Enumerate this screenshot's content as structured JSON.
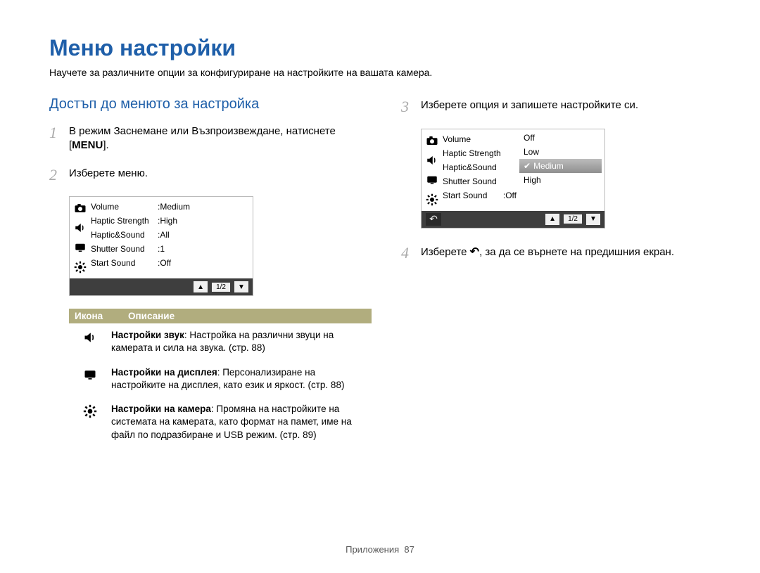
{
  "title": "Меню настройки",
  "intro": "Научете за различните опции за конфигуриране на настройките на вашата камера.",
  "section_head": "Достъп до менюто за настройка",
  "steps": {
    "s1_a": "В режим Заснемане или Възпроизвеждане, натиснете [",
    "s1_menu": "MENU",
    "s1_b": "].",
    "s2": "Изберете меню.",
    "s3": "Изберете опция и запишете настройките си.",
    "s4_a": "Изберете ",
    "s4_b": ", за да се върнете на предишния екран."
  },
  "step_numbers": [
    "1",
    "2",
    "3",
    "4"
  ],
  "cam1": {
    "rows": [
      {
        "label": "Volume",
        "val": ":Medium"
      },
      {
        "label": "Haptic Strength",
        "val": ":High"
      },
      {
        "label": "Haptic&Sound",
        "val": ":All"
      },
      {
        "label": "Shutter Sound",
        "val": ":1"
      },
      {
        "label": "Start Sound",
        "val": ":Off"
      }
    ],
    "page": "1/2"
  },
  "cam2": {
    "rows": [
      {
        "label": "Volume"
      },
      {
        "label": "Haptic Strength"
      },
      {
        "label": "Haptic&Sound"
      },
      {
        "label": "Shutter Sound"
      },
      {
        "label": "Start Sound",
        "val": ":Off"
      }
    ],
    "options": [
      "Off",
      "Low",
      "Medium",
      "High"
    ],
    "selected": 2,
    "page": "1/2"
  },
  "icons": {
    "camera_label": "camera-icon",
    "sound_label": "sound-settings-icon",
    "display_label": "display-settings-icon",
    "camgear_label": "camera-gear-icon",
    "up_label": "up-icon",
    "down_label": "down-icon",
    "back_label": "back-icon"
  },
  "table": {
    "head1": "Икона",
    "head2": "Описание",
    "rows": [
      {
        "icon": "sound",
        "bold": "Настройки звук",
        "text": ": Настройка на различни звуци на камерата и сила на звука. (стр. 88)"
      },
      {
        "icon": "display",
        "bold": "Настройки на дисплея",
        "text": ": Персонализиране на настройките на дисплея, като език и яркост. (стр. 88)"
      },
      {
        "icon": "camgear",
        "bold": "Настройки на камера",
        "text": ": Промяна на настройките на системата на камерата, като формат на памет, име на файл по подразбиране и USB режим. (стр. 89)"
      }
    ]
  },
  "footer": {
    "label": "Приложения",
    "num": "87"
  }
}
